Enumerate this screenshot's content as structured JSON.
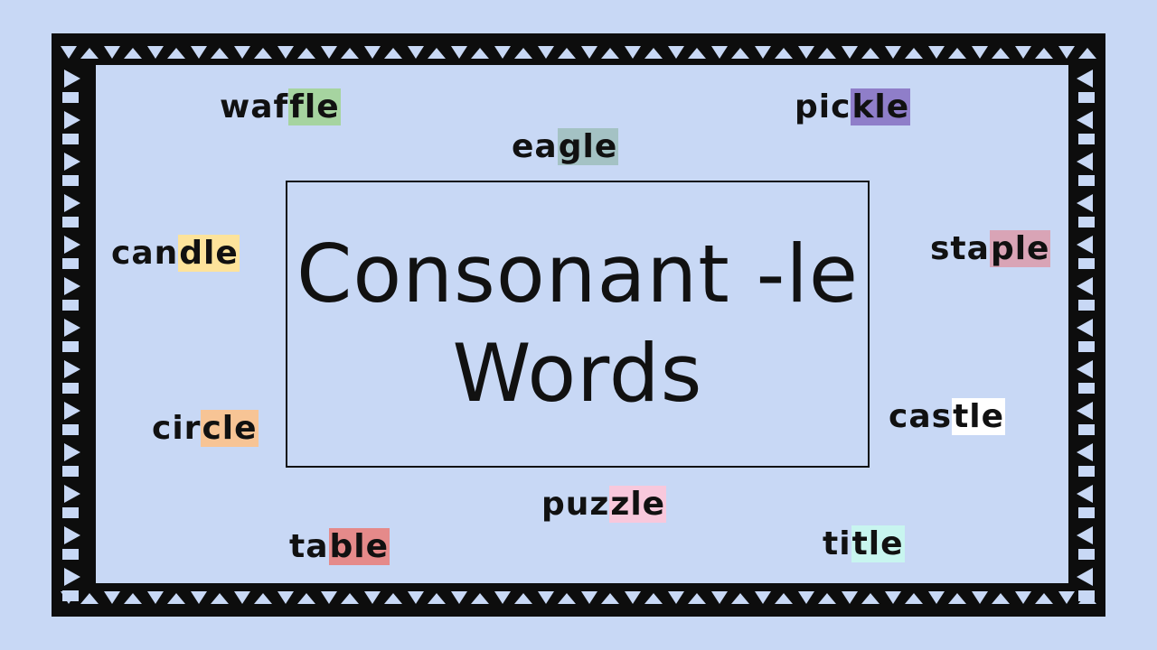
{
  "title": {
    "line1": "Consonant -le",
    "line2": "Words"
  },
  "words": [
    {
      "id": "waffle",
      "prefix": "waf",
      "suffix": "fle",
      "color": "#a6d4a0"
    },
    {
      "id": "eagle",
      "prefix": "ea",
      "suffix": "gle",
      "color": "#a4c2c4"
    },
    {
      "id": "pickle",
      "prefix": "pic",
      "suffix": "kle",
      "color": "#8f7ec9"
    },
    {
      "id": "candle",
      "prefix": "can",
      "suffix": "dle",
      "color": "#fde39b"
    },
    {
      "id": "staple",
      "prefix": "sta",
      "suffix": "ple",
      "color": "#d9a4b6"
    },
    {
      "id": "circle",
      "prefix": "cir",
      "suffix": "cle",
      "color": "#f7c495"
    },
    {
      "id": "castle",
      "prefix": "cas",
      "suffix": "tle",
      "color": "#ffffff"
    },
    {
      "id": "puzzle",
      "prefix": "puz",
      "suffix": "zle",
      "color": "#f8c8dc"
    },
    {
      "id": "table",
      "prefix": "ta",
      "suffix": "ble",
      "color": "#e58a8a"
    },
    {
      "id": "title",
      "prefix": "ti",
      "suffix": "tle",
      "color": "#c8f5ef"
    }
  ]
}
